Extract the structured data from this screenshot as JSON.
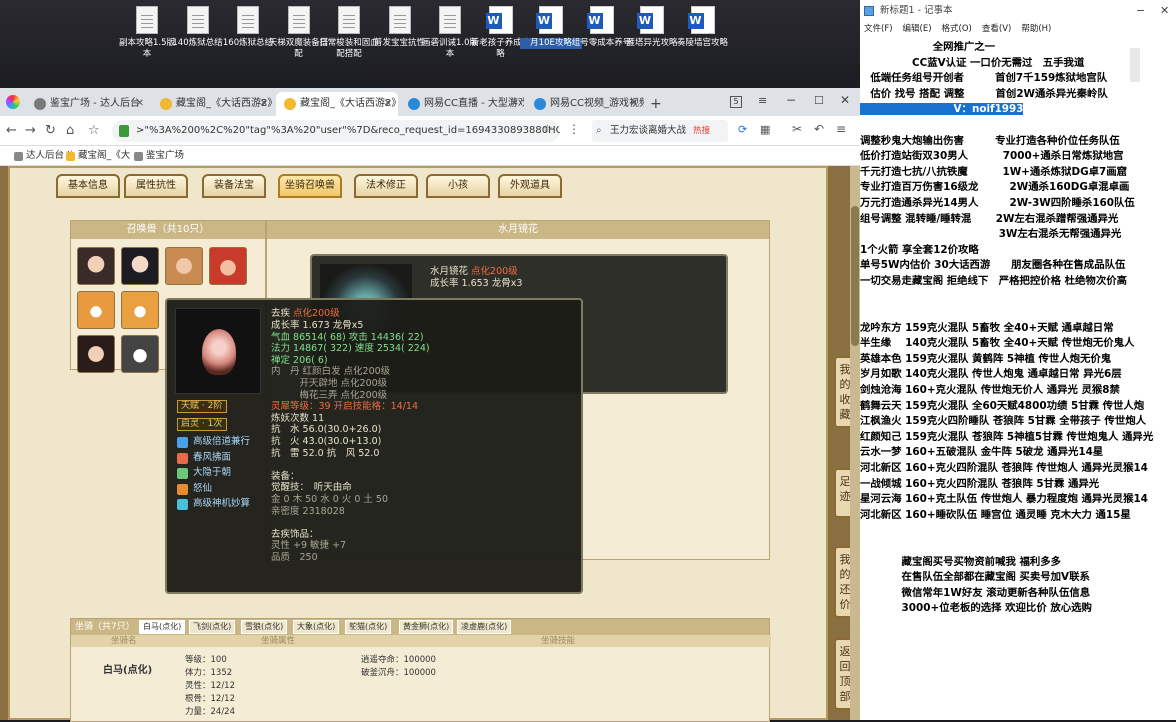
{
  "desktop": {
    "icons": [
      {
        "label": "副本攻略1.5版本",
        "kind": "doc"
      },
      {
        "label": "140炼狱总结",
        "kind": "doc"
      },
      {
        "label": "160炼狱总结",
        "kind": "doc"
      },
      {
        "label": "天梯双魔装备搭配",
        "kind": "doc"
      },
      {
        "label": "日常梭装和固血配搭配",
        "kind": "doc"
      },
      {
        "label": "普发宝宝抗性",
        "kind": "doc"
      },
      {
        "label": "画砻训诫1.0版本",
        "kind": "doc"
      },
      {
        "label": "新老孩子养成攻略",
        "kind": "word"
      },
      {
        "label": "月10E攻略",
        "kind": "word"
      },
      {
        "label": "组号零成本养号",
        "kind": "word"
      },
      {
        "label": "雁塔异光攻略",
        "kind": "word"
      },
      {
        "label": "奏陵墙宫攻略",
        "kind": "word"
      }
    ]
  },
  "browser": {
    "tabs": [
      {
        "label": "鉴宝广场 - 达人后台"
      },
      {
        "label": "藏宝阁_《大话西游2》"
      },
      {
        "label": "藏宝阁_《大话西游2》"
      },
      {
        "label": "网易CC直播 - 大型游戏"
      },
      {
        "label": "网易CC视频_游戏视频"
      }
    ],
    "tab_count": "5",
    "url": ">\"%3A%200%2C%20\"tag\"%3A%20\"user\"%7D&reco_request_id=1694330893880HOco-",
    "search": "王力宏谈离婚大战",
    "search_badge": "热搜",
    "bookmarks": [
      "达人后台 Ii",
      "藏宝阁_《大",
      "鉴宝广场"
    ]
  },
  "game": {
    "tabs": [
      "基本信息",
      "属性抗性",
      "装备法宝",
      "坐骑召唤兽",
      "法术修正",
      "小孩",
      "外观道具"
    ],
    "active_tab": 3,
    "summon_list_title": "召唤兽（共10只）",
    "detail_title": "水月镜花",
    "back_tip": {
      "name": "水月镜花",
      "tag": "点化200级",
      "growth": "成长率 1.653 龙骨x3"
    },
    "tip": {
      "name": "去疾",
      "tag": "点化200级",
      "lines": [
        {
          "t": "成长率 1.673 龙骨x5",
          "c": ""
        },
        {
          "t": "气血 86514( 68) 攻击 14436( 22)",
          "c": "grn"
        },
        {
          "t": "法力 14867( 322) 速度 2534( 224)",
          "c": "grn"
        },
        {
          "t": "禅定 206( 6)",
          "c": "grn"
        },
        {
          "t": "内　丹 红颜白发 点化200级",
          "c": "gry"
        },
        {
          "t": "　　　开天辟地 点化200级",
          "c": "gry"
        },
        {
          "t": "　　　梅花三弄 点化200级",
          "c": "gry"
        },
        {
          "t": "灵犀等级：39 开启技能格：14/14",
          "c": "red"
        },
        {
          "t": "炼妖次数 11",
          "c": ""
        },
        {
          "t": "抗　水 56.0(30.0+26.0)",
          "c": ""
        },
        {
          "t": "抗　火 43.0(30.0+13.0)",
          "c": ""
        },
        {
          "t": "抗　雷 52.0 抗　风 52.0",
          "c": ""
        },
        {
          "t": "",
          "c": ""
        },
        {
          "t": "装备：",
          "c": ""
        },
        {
          "t": "觉醒技：　听天由命",
          "c": ""
        },
        {
          "t": "金 0 木 50 水 0 火 0 土 50",
          "c": "gry"
        },
        {
          "t": "亲密度 2318028",
          "c": "gry"
        },
        {
          "t": "",
          "c": ""
        },
        {
          "t": "去疾饰品：",
          "c": ""
        },
        {
          "t": "灵性 +9 敏捷 +7",
          "c": "gry"
        },
        {
          "t": "品质　250",
          "c": "gry"
        }
      ],
      "tianfu": "天赋 · 2阶",
      "qiling": "启灵 · 1次",
      "skills": [
        "高级倍道兼行",
        "春风拂面",
        "大隐于朝",
        "怒仙",
        "高级神机妙算"
      ]
    },
    "mount": {
      "title": "坐骑（共7只）",
      "tabs": [
        "白马(点化)",
        "飞剑(点化)",
        "雪狼(点化)",
        "大象(点化)",
        "鸵猫(点化)",
        "黄金狮(点化)",
        "凌虚鹿(点化)"
      ],
      "hdr_name": "坐骑名",
      "hdr_attr": "坐骑属性",
      "hdr_skill": "坐骑技能",
      "name": "白马(点化)",
      "attrs": [
        "等级：100",
        "体力：1352",
        "灵性：12/12",
        "根骨：12/12",
        "力量：24/24"
      ],
      "skills": [
        "逍遥夺命：100000",
        "破釜沉舟：100000"
      ]
    },
    "side_buttons": [
      "我的收藏",
      "足迹",
      "我的还价",
      "返回顶部"
    ]
  },
  "notepad": {
    "title": "新标题1 - 记事本",
    "menu": [
      "文件(F)",
      "编辑(E)",
      "格式(O)",
      "查看(V)",
      "帮助(H)"
    ],
    "lines": [
      {
        "t": "　　　　　　　全网推广之一",
        "hl": false
      },
      {
        "t": "　　　　　CC蓝V认证 一口价无需过　五手我道",
        "hl": false
      },
      {
        "t": "　低端任务组号开创者　　　首创7千159炼狱地宫队",
        "hl": false
      },
      {
        "t": "　估价 找号 搭配 调整　　　首创2W通杀异光秦岭队",
        "hl": false
      },
      {
        "t": "　　　　　　　　　V：noif1993",
        "hl": true
      },
      {
        "t": "",
        "hl": false
      },
      {
        "t": "调整秒鬼大炮输出伤害　　　专业打造各种价位任务队伍",
        "hl": false
      },
      {
        "t": "低价打造站街双30男人　　　 7000+通杀日常炼狱地宫",
        "hl": false
      },
      {
        "t": "千元打造七抗/八抗铁魔　　　 1W+通杀炼狱DG卓7画窟",
        "hl": false
      },
      {
        "t": "专业打造百万伤害16级龙　　　2W通杀160DG卓混卓画",
        "hl": false
      },
      {
        "t": "万元打造通杀异光14男人　　　2W-3W四阶睡杀160队伍",
        "hl": false
      },
      {
        "t": "组号调整 混转睡/睡转混　　 2W左右混杀蹭帮强通异光",
        "hl": false
      },
      {
        "t": "　　　　　　　　　　　　　 3W左右混杀无帮强通异光",
        "hl": false
      },
      {
        "t": "1个火箭 享全套12价攻略",
        "hl": false
      },
      {
        "t": "单号5W内估价 30大话西游　　朋友圈各种在售成品队伍",
        "hl": false
      },
      {
        "t": "一切交易走藏宝阁 拒绝线下　严格把控价格 杜绝物次价高",
        "hl": false
      },
      {
        "t": "",
        "hl": false
      },
      {
        "t": "",
        "hl": false
      },
      {
        "t": "龙吟东方 159克火混队 5畜牧 全40+天赋 通卓越日常",
        "hl": false
      },
      {
        "t": "半生缘　 140克火混队 5畜牧 全40+天赋 传世炮无价鬼人",
        "hl": false
      },
      {
        "t": "英雄本色 159克火混队 黄鹤阵 5神植 传世人炮无价鬼",
        "hl": false
      },
      {
        "t": "岁月如歌 140克火混队 传世人炮鬼 通卓越日常 异光6层",
        "hl": false
      },
      {
        "t": "剑烛沧海 160+克火混队 传世炮无价人 通异光 灵猴8禁",
        "hl": false
      },
      {
        "t": "鹤舞云天 159克火混队 全60天赋4800功绩 5甘霖 传世人炮",
        "hl": false
      },
      {
        "t": "江枫渔火 159克火四阶睡队 苍狼阵 5甘霖 全带孩子 传世炮人",
        "hl": false
      },
      {
        "t": "红颜知己 159克火混队 苍狼阵 5神植5甘霖 传世炮鬼人 通异光",
        "hl": false
      },
      {
        "t": "云水一梦 160+五破混队 金牛阵 5破龙 通异光14星",
        "hl": false
      },
      {
        "t": "河北新区 160+克火四阶混队 苍狼阵 传世炮人 通异光灵猴14",
        "hl": false
      },
      {
        "t": "一战倾城 160+克火四阶混队 苍狼阵 5甘霖 通异光",
        "hl": false
      },
      {
        "t": "星河云海 160+克土队伍 传世炮人 暴力程度炮 通异光灵猴14",
        "hl": false
      },
      {
        "t": "河北新区 160+睡砍队伍 睡宫位 通灵睡 克木大力 通15星",
        "hl": false
      },
      {
        "t": "",
        "hl": false
      },
      {
        "t": "",
        "hl": false
      },
      {
        "t": "　　　　藏宝阁买号买物资前喊我 福利多多",
        "hl": false
      },
      {
        "t": "　　　　在售队伍全部都在藏宝阁 买卖号加V联系",
        "hl": false
      },
      {
        "t": "　　　　微信常年1W好友 滚动更新各种队伍信息",
        "hl": false
      },
      {
        "t": "　　　　3000+位老板的选择 欢迎比价 放心选购",
        "hl": false
      }
    ]
  },
  "colors": {
    "game_bg": "#efe6cc",
    "tab_border": "#8a6a30",
    "highlight": "#1872d0"
  }
}
